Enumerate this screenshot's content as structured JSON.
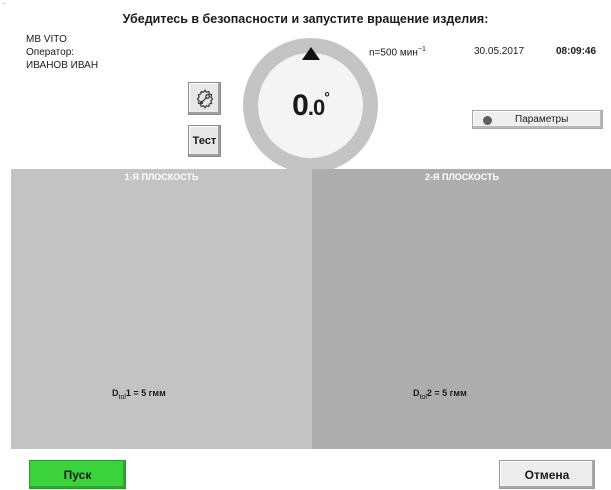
{
  "corner_mark": "ˇ",
  "header": {
    "message": "Убедитесь в безопасности и запустите вращение изделия:"
  },
  "info": {
    "model": "MB VITO",
    "operator_label": "Оператор:",
    "operator_name": "ИВАНОВ ИВАН",
    "speed_text": "n=500 мин",
    "speed_unit_sup": "−1",
    "date": "30.05.2017",
    "time": "08:09:46"
  },
  "gauge": {
    "angle_int": "0",
    "angle_frac": ".0",
    "angle_unit": "°",
    "ring_color": "#c4c4c4"
  },
  "buttons": {
    "settings_icon": "gear-wrench-icon",
    "test_label": "Тест",
    "params_label": "Параметры",
    "start_label": "Пуск",
    "cancel_label": "Отмена"
  },
  "planes": [
    {
      "title": "1-Я ПЛОСКОСТЬ",
      "tol_prefix": "D",
      "tol_sub": "tol",
      "tol_value": "1 = 5 гмм"
    },
    {
      "title": "2-Я ПЛОСКОСТЬ",
      "tol_prefix": "D",
      "tol_sub": "tol",
      "tol_value": "2 = 5 гмм"
    }
  ],
  "colors": {
    "start": "#3cd23c",
    "plane1": "#c3c3c3",
    "plane2": "#adadad"
  }
}
